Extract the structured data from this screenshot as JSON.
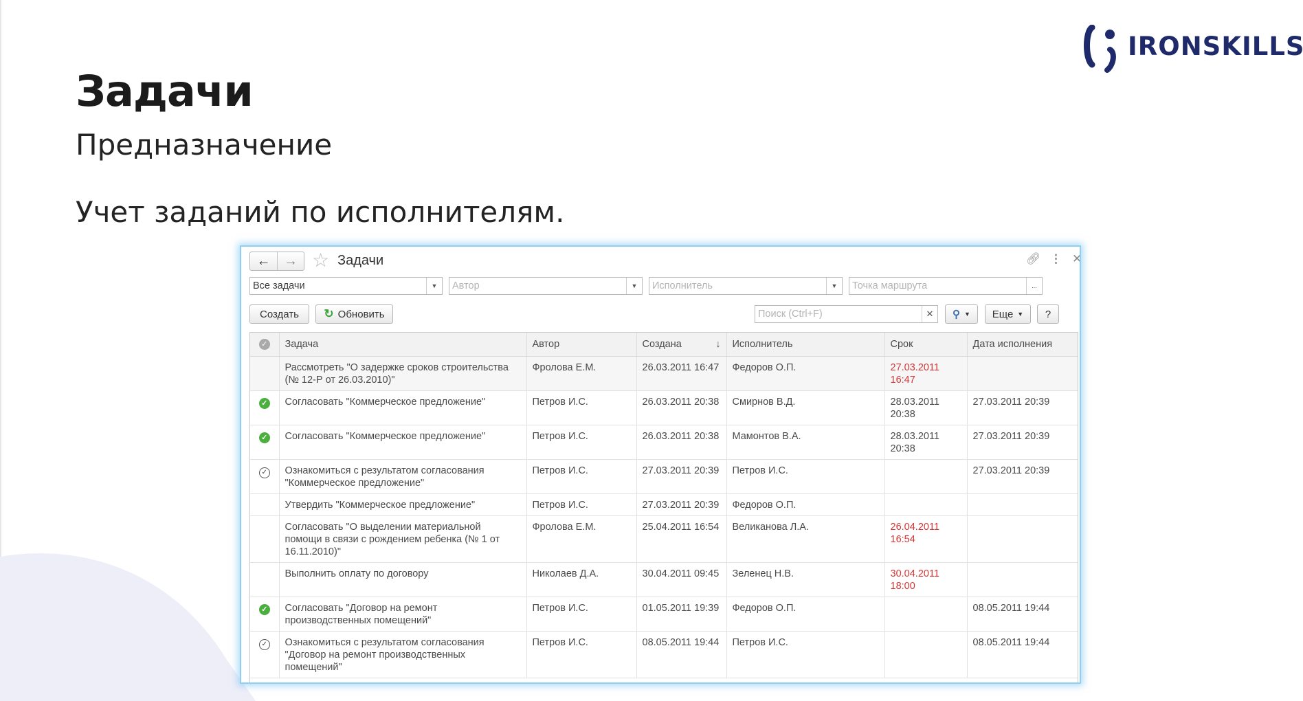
{
  "slide": {
    "title": "Задачи",
    "subtitle": "Предназначение",
    "description": "Учет заданий по исполнителям."
  },
  "logo": {
    "text": "IRONSKILLS",
    "icon": "ironskills-logo-icon",
    "color": "#1f2a6b"
  },
  "window": {
    "title": "Задачи",
    "icons": {
      "back": "arrow-left-icon",
      "forward": "arrow-right-icon",
      "favorite": "star-icon",
      "link": "link-icon",
      "menu": "more-vert-icon",
      "close": "close-icon"
    },
    "filters": {
      "tasks": {
        "value": "Все задачи"
      },
      "author": {
        "placeholder": "Автор"
      },
      "executor": {
        "placeholder": "Исполнитель"
      },
      "route_point": {
        "placeholder": "Точка маршрута"
      }
    },
    "toolbar": {
      "create_label": "Создать",
      "refresh_label": "Обновить",
      "search_placeholder": "Поиск (Ctrl+F)",
      "more_label": "Еще",
      "help_label": "?"
    },
    "table": {
      "columns": [
        "Задача",
        "Автор",
        "Создана",
        "Исполнитель",
        "Срок",
        "Дата исполнения"
      ],
      "rows": [
        {
          "status": "",
          "task": "Рассмотреть \"О задержке сроков строительства (№ 12-Р от 26.03.2010)\"",
          "author": "Фролова Е.М.",
          "created": "26.03.2011 16:47",
          "executor": "Федоров О.П.",
          "due": "27.03.2011 16:47",
          "due_overdue": true,
          "done": ""
        },
        {
          "status": "done",
          "task": "Согласовать \"Коммерческое предложение\"",
          "author": "Петров И.С.",
          "created": "26.03.2011 20:38",
          "executor": "Смирнов В.Д.",
          "due": "28.03.2011 20:38",
          "due_overdue": false,
          "done": "27.03.2011 20:39"
        },
        {
          "status": "done",
          "task": "Согласовать \"Коммерческое предложение\"",
          "author": "Петров И.С.",
          "created": "26.03.2011 20:38",
          "executor": "Мамонтов В.А.",
          "due": "28.03.2011 20:38",
          "due_overdue": false,
          "done": "27.03.2011 20:39"
        },
        {
          "status": "ack",
          "task": "Ознакомиться с результатом согласования \"Коммерческое предложение\"",
          "author": "Петров И.С.",
          "created": "27.03.2011 20:39",
          "executor": "Петров И.С.",
          "due": "",
          "due_overdue": false,
          "done": "27.03.2011 20:39"
        },
        {
          "status": "",
          "task": "Утвердить \"Коммерческое предложение\"",
          "author": "Петров И.С.",
          "created": "27.03.2011 20:39",
          "executor": "Федоров О.П.",
          "due": "",
          "due_overdue": false,
          "done": ""
        },
        {
          "status": "",
          "task": "Согласовать \"О выделении материальной помощи в связи с рождением ребенка (№ 1 от 16.11.2010)\"",
          "author": "Фролова Е.М.",
          "created": "25.04.2011 16:54",
          "executor": "Великанова Л.А.",
          "due": "26.04.2011 16:54",
          "due_overdue": true,
          "done": ""
        },
        {
          "status": "",
          "task": "Выполнить оплату по договору",
          "author": "Николаев Д.А.",
          "created": "30.04.2011 09:45",
          "executor": "Зеленец Н.В.",
          "due": "30.04.2011 18:00",
          "due_overdue": true,
          "done": ""
        },
        {
          "status": "done",
          "task": "Согласовать \"Договор на ремонт производственных помещений\"",
          "author": "Петров И.С.",
          "created": "01.05.2011 19:39",
          "executor": "Федоров О.П.",
          "due": "",
          "due_overdue": false,
          "done": "08.05.2011 19:44"
        },
        {
          "status": "ack",
          "task": "Ознакомиться с результатом согласования \"Договор на ремонт производственных помещений\"",
          "author": "Петров И.С.",
          "created": "08.05.2011 19:44",
          "executor": "Петров И.С.",
          "due": "",
          "due_overdue": false,
          "done": "08.05.2011 19:44"
        }
      ]
    }
  },
  "colors": {
    "accent_blue": "#8fd0f2",
    "overdue_red": "#d63535",
    "done_green": "#4aaf3c",
    "blob": "#eeeef8"
  }
}
